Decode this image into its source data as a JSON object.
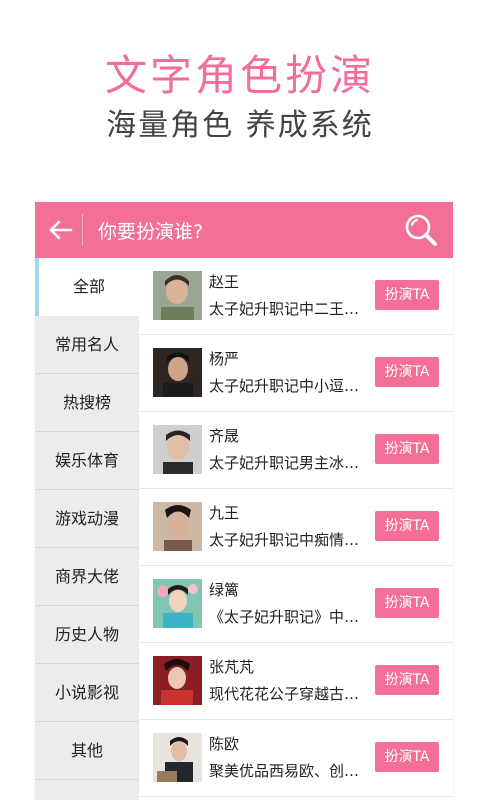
{
  "promo": {
    "title": "文字角色扮演",
    "subtitle": "海量角色 养成系统"
  },
  "header": {
    "back_icon": "back-arrow-icon",
    "title": "你要扮演谁?",
    "search_icon": "search-icon"
  },
  "sidebar": {
    "items": [
      {
        "label": "全部",
        "active": true
      },
      {
        "label": "常用名人"
      },
      {
        "label": "热搜榜"
      },
      {
        "label": "娱乐体育"
      },
      {
        "label": "游戏动漫"
      },
      {
        "label": "商界大佬"
      },
      {
        "label": "历史人物"
      },
      {
        "label": "小说影视"
      },
      {
        "label": "其他"
      }
    ]
  },
  "characters": [
    {
      "name": "赵王",
      "desc": "太子妃升职记中二王…",
      "button": "扮演TA"
    },
    {
      "name": "杨严",
      "desc": "太子妃升职记中小逗…",
      "button": "扮演TA"
    },
    {
      "name": "齐晟",
      "desc": "太子妃升职记男主冰…",
      "button": "扮演TA"
    },
    {
      "name": "九王",
      "desc": "太子妃升职记中痴情…",
      "button": "扮演TA"
    },
    {
      "name": "绿篱",
      "desc": "《太子妃升职记》中…",
      "button": "扮演TA"
    },
    {
      "name": "张芃芃",
      "desc": "现代花花公子穿越古…",
      "button": "扮演TA"
    },
    {
      "name": "陈欧",
      "desc": "聚美优品西易欧、创…",
      "button": "扮演TA"
    }
  ],
  "colors": {
    "accent": "#f36f97",
    "sidebar_bg": "#ececec",
    "active_indicator": "#9fd8ee"
  }
}
